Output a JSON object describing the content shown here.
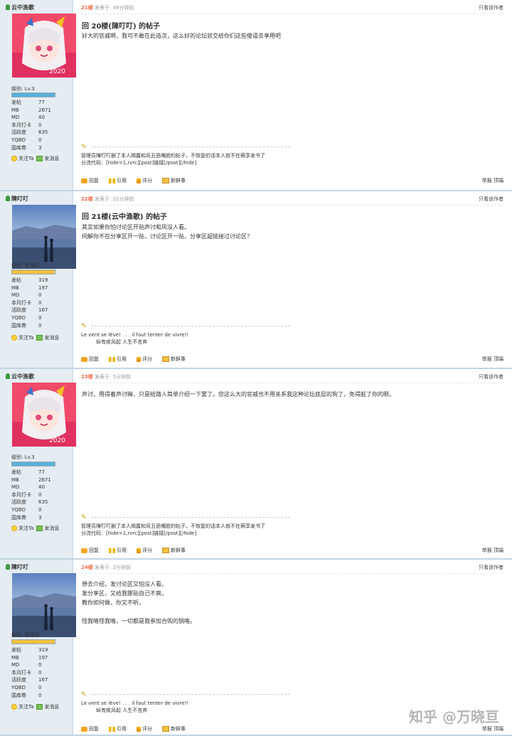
{
  "posts": [
    {
      "username": "云中渔歌",
      "avatar": "anime",
      "level": "级别: Lv.3",
      "stats": [
        [
          "发帖",
          "77"
        ],
        [
          "MB",
          "2671"
        ],
        [
          "MD",
          "40"
        ],
        [
          "本月打卡",
          "0"
        ],
        [
          "活跃度",
          "635"
        ],
        [
          "YQBD",
          "0"
        ],
        [
          "国库券",
          "3"
        ]
      ],
      "follow": "关注Ta",
      "message": "发消息",
      "floor": "21楼",
      "time": "发表于: 49分钟前",
      "only_author": "只看该作者",
      "title": "回 20楼(陳叮叮) 的帖子",
      "content": "好大的官威啊，我可不敢在此造次，这么好的论坛就交给你们这些傻逼去享用吧",
      "signature": [
        "管理员陳叮叮删了本人揭露和风丑恶嘴脸的帖子，不恢复的话本人就不在萌享发书了",
        "分流代码：[hide=1,rvrc][post]链接[/post][/hide]"
      ],
      "actions": [
        "回复",
        "引用",
        "评分",
        "新鲜事"
      ],
      "report": "举报 顶端"
    },
    {
      "username": "陳叮叮",
      "avatar": "lake",
      "level": "级别: 管理员",
      "stats": [
        [
          "发帖",
          "319"
        ],
        [
          "MB",
          "197"
        ],
        [
          "MD",
          "0"
        ],
        [
          "本月打卡",
          "0"
        ],
        [
          "活跃度",
          "167"
        ],
        [
          "YQBD",
          "0"
        ],
        [
          "国库券",
          "0"
        ]
      ],
      "follow": "关注Ta",
      "message": "发消息",
      "floor": "22楼",
      "time": "发表于: 22分钟前",
      "only_author": "只看该作者",
      "title": "回 21楼(云中渔歌) 的帖子",
      "content": "其实如果你怕讨论区开贴声讨和风没人看。\n伺解你不在分享区开一贴，讨论区开一贴，分享区超链接过讨论区？",
      "signature": [
        "Le vent se lève! . . . il faut tenter de vivre!!",
        "　　　纵有疾风起 人生不言弃"
      ],
      "actions": [
        "回复",
        "引用",
        "评分",
        "新鲜事"
      ],
      "report": "举报 顶端"
    },
    {
      "username": "云中渔歌",
      "avatar": "anime",
      "level": "级别: Lv.3",
      "stats": [
        [
          "发帖",
          "77"
        ],
        [
          "MB",
          "2671"
        ],
        [
          "MD",
          "40"
        ],
        [
          "本月打卡",
          "0"
        ],
        [
          "活跃度",
          "635"
        ],
        [
          "YQBD",
          "0"
        ],
        [
          "国库券",
          "3"
        ]
      ],
      "follow": "关注Ta",
      "message": "发消息",
      "floor": "23楼",
      "time": "发表于: 5分钟前",
      "only_author": "只看该作者",
      "title": "",
      "content": "声讨，用得着声讨嘛，只是给路人简单介绍一下罢了。您这么大的官威也不用关系我这种论坛底层的狗了，免得脏了你的眼。",
      "signature": [
        "管理员陳叮叮删了本人揭露和风丑恶嘴脸的帖子，不恢复的话本人就不在萌享发书了",
        "分流代码：[hide=1,rvrc][post]链接[/post][/hide]"
      ],
      "actions": [
        "回复",
        "引用",
        "评分",
        "新鲜事"
      ],
      "report": "举报 顶端"
    },
    {
      "username": "陳叮叮",
      "avatar": "lake",
      "level": "级别: 管理员",
      "stats": [
        [
          "发帖",
          "319"
        ],
        [
          "MB",
          "197"
        ],
        [
          "MD",
          "0"
        ],
        [
          "本月打卡",
          "0"
        ],
        [
          "活跃度",
          "167"
        ],
        [
          "YQBD",
          "0"
        ],
        [
          "国库券",
          "0"
        ]
      ],
      "follow": "关注Ta",
      "message": "发消息",
      "floor": "24楼",
      "time": "发表于: 2分钟前",
      "only_author": "只看该作者",
      "title": "",
      "content": "想去介绍，发讨论区又怕没人看。\n发分享区，又给我挪贴自己不爽。\n教你如何做，你又不听。\n\n怪我咯怪我咯，一切都是我参加合购的锅咯。",
      "signature": [
        "Le vent se lève! . . . il faut tenter de vivre!!",
        "　　　纵有疾风起 人生不言弃"
      ],
      "actions": [
        "回复",
        "引用",
        "评分",
        "新鲜事"
      ],
      "report": "举报 顶端"
    }
  ],
  "watermark": "知乎 @万晓亘",
  "colors": {
    "floor": "#f26c4f",
    "sidebar": "#e5edf2",
    "border": "#c2d5e3",
    "lv_user": "#5bb0d8",
    "lv_admin": "#f0c040"
  }
}
